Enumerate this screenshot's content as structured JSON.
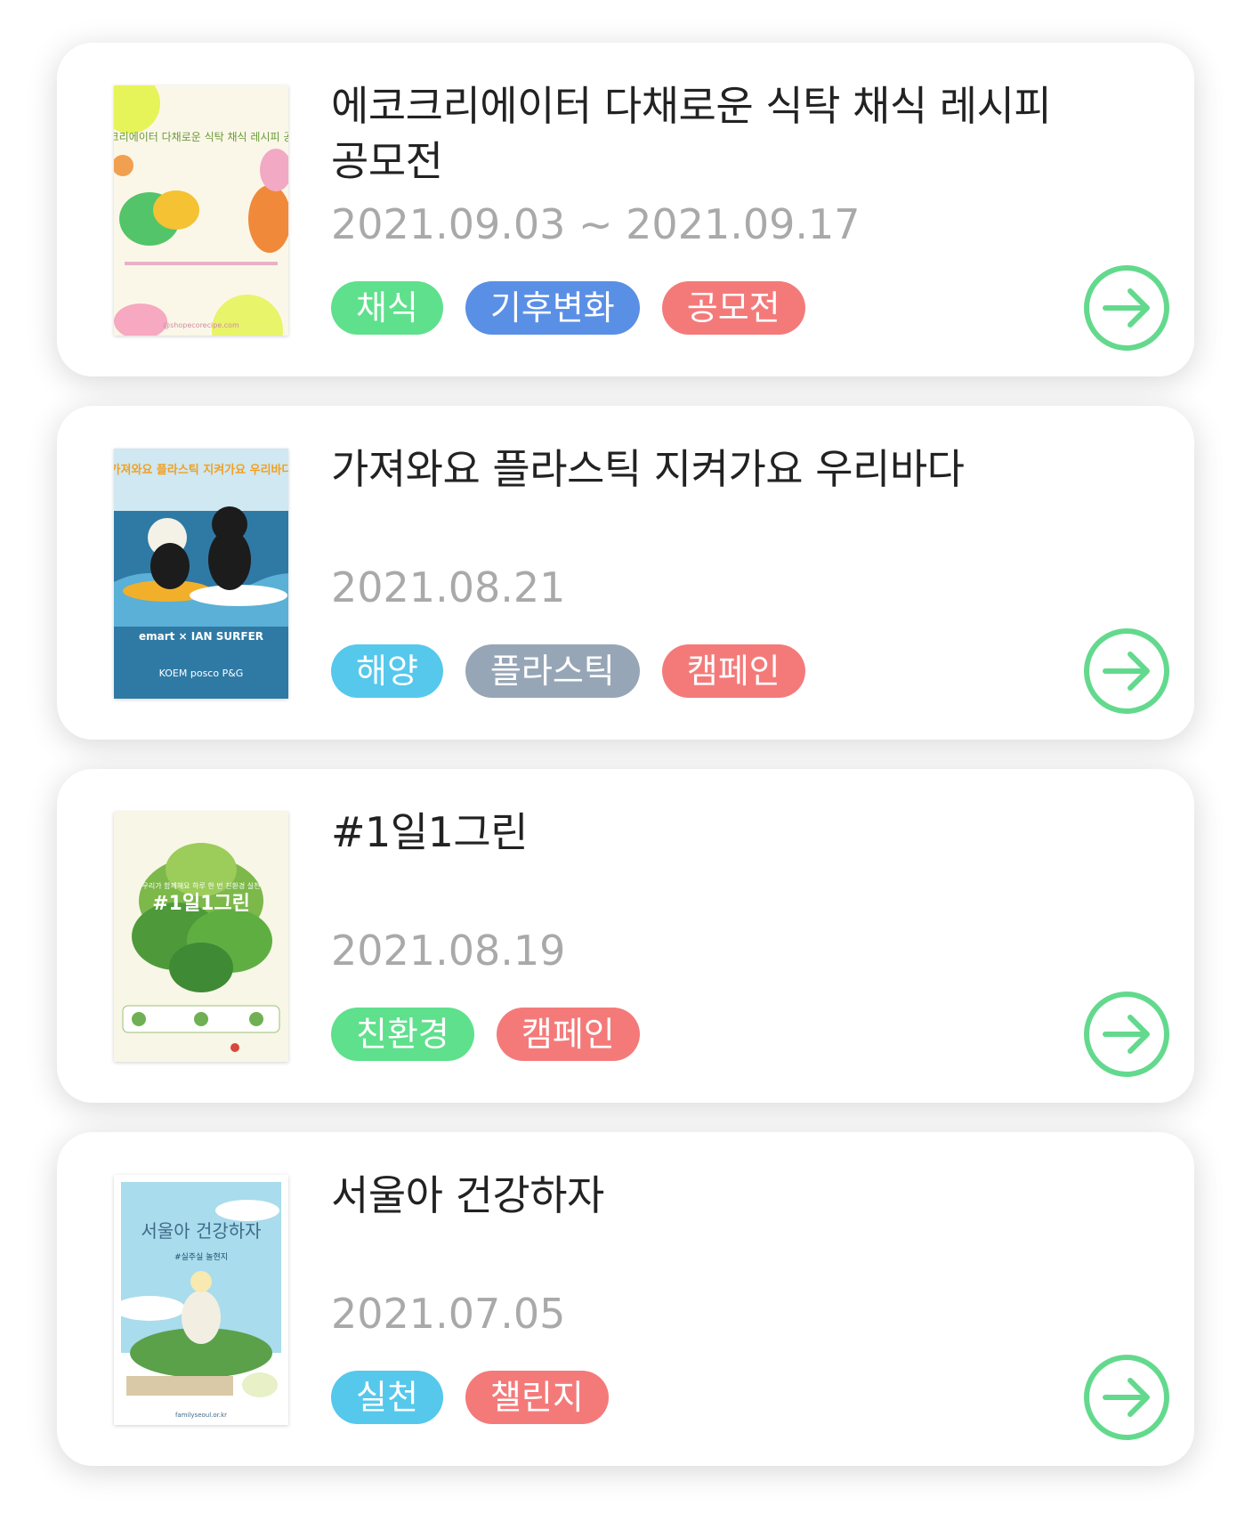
{
  "colors": {
    "green": "#5fe08c",
    "blue": "#5a8fe6",
    "red": "#f47a7a",
    "sky": "#55c8ec",
    "gray": "#97a6b6",
    "arrow": "#63d98d"
  },
  "cards": [
    {
      "title": "에코크리에이터 다채로운 식탁 채식 레시피 공모전",
      "date": "2021.09.03 ~ 2021.09.17",
      "tags": [
        {
          "label": "채식",
          "color": "#5fe08c"
        },
        {
          "label": "기후변화",
          "color": "#5a8fe6"
        },
        {
          "label": "공모전",
          "color": "#f47a7a"
        }
      ],
      "poster": {
        "heading": "에코크리에이터 다채로운 식탁 채식 레시피 공모전",
        "footer": "@shopecorecipe.com",
        "bg": "#fbf7e8"
      }
    },
    {
      "title": "가져와요 플라스틱 지켜가요 우리바다",
      "date": "2021.08.21",
      "tags": [
        {
          "label": "해양",
          "color": "#55c8ec"
        },
        {
          "label": "플라스틱",
          "color": "#97a6b6"
        },
        {
          "label": "캠페인",
          "color": "#f47a7a"
        }
      ],
      "poster": {
        "heading": "가져와요 플라스틱 지켜가요 우리바다",
        "brand": "emart × IAN SURFER",
        "sponsors": "KOEM posco P&G",
        "bg": "#2f7aa5"
      }
    },
    {
      "title": "#1일1그린",
      "date": "2021.08.19",
      "tags": [
        {
          "label": "친환경",
          "color": "#5fe08c"
        },
        {
          "label": "캠페인",
          "color": "#f47a7a"
        }
      ],
      "poster": {
        "heading": "#1일1그린",
        "subheading": "우리가 함께해요 하루 한 번 친환경 실천",
        "bg": "#f8f6e6"
      }
    },
    {
      "title": "서울아 건강하자",
      "date": "2021.07.05",
      "tags": [
        {
          "label": "실천",
          "color": "#55c8ec"
        },
        {
          "label": "챌린지",
          "color": "#f47a7a"
        }
      ],
      "poster": {
        "heading": "서울아 건강하자",
        "subheading": "#실주실 놀현지",
        "footer": "familyseoul.or.kr",
        "bg": "#a9dcec"
      }
    }
  ]
}
